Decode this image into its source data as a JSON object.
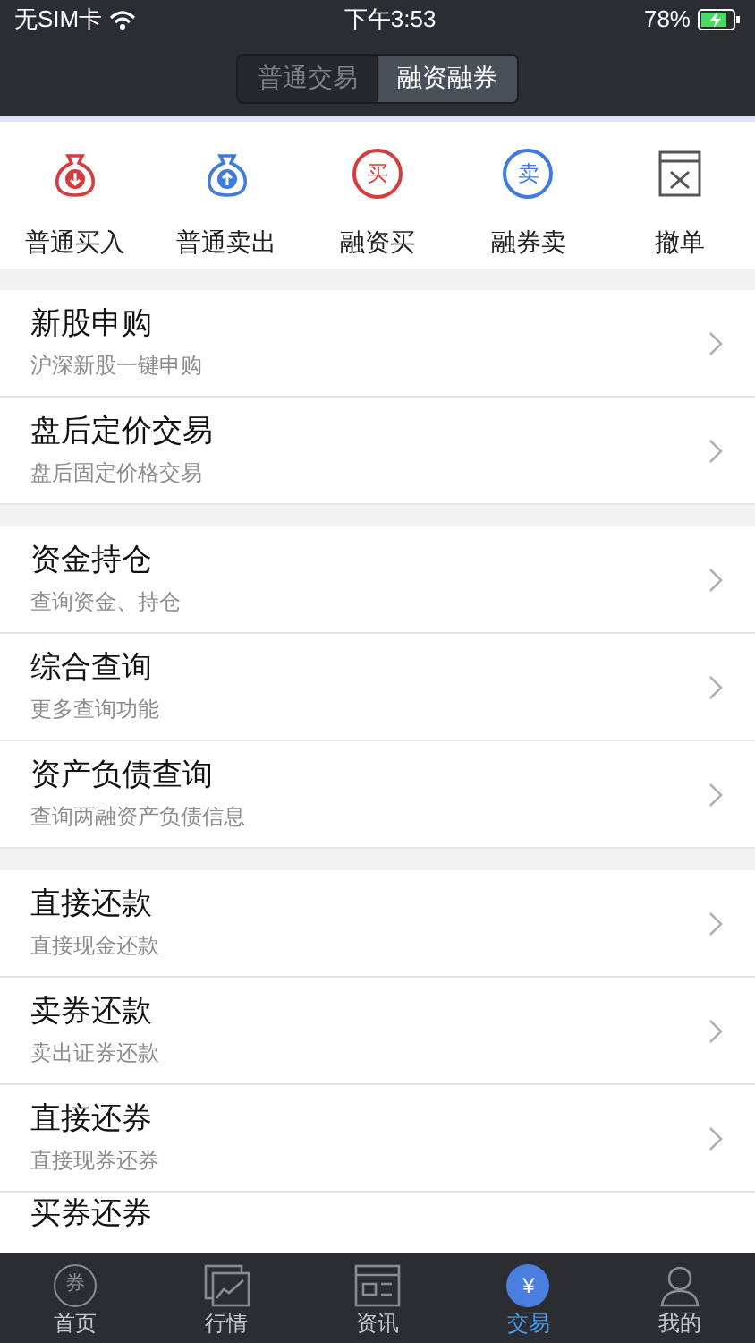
{
  "status_bar": {
    "carrier": "无SIM卡",
    "time": "下午3:53",
    "battery": "78%"
  },
  "segments": [
    {
      "label": "普通交易",
      "selected": false
    },
    {
      "label": "融资融券",
      "selected": true
    }
  ],
  "quick_actions": [
    {
      "label": "普通买入",
      "kind": "bag",
      "color": "#d63c3c"
    },
    {
      "label": "普通卖出",
      "kind": "bag",
      "color": "#3d7be0"
    },
    {
      "label": "融资买",
      "kind": "coin",
      "glyph": "买",
      "color": "#d63c3c"
    },
    {
      "label": "融券卖",
      "kind": "coin",
      "glyph": "卖",
      "color": "#3d7be0"
    },
    {
      "label": "撤单",
      "kind": "cancel",
      "color": "#555555"
    }
  ],
  "sections": [
    {
      "items": [
        {
          "title": "新股申购",
          "subtitle": "沪深新股一键申购"
        },
        {
          "title": "盘后定价交易",
          "subtitle": "盘后固定价格交易"
        }
      ]
    },
    {
      "items": [
        {
          "title": "资金持仓",
          "subtitle": "查询资金、持仓"
        },
        {
          "title": "综合查询",
          "subtitle": "更多查询功能"
        },
        {
          "title": "资产负债查询",
          "subtitle": "查询两融资产负债信息"
        }
      ]
    },
    {
      "items": [
        {
          "title": "直接还款",
          "subtitle": "直接现金还款"
        },
        {
          "title": "卖券还款",
          "subtitle": "卖出证券还款"
        },
        {
          "title": "直接还券",
          "subtitle": "直接现券还券"
        },
        {
          "title": "买券还券"
        }
      ]
    }
  ],
  "tab_bar": [
    {
      "label": "首页",
      "kind": "coupon",
      "glyph": "券",
      "selected": false
    },
    {
      "label": "行情",
      "kind": "chart",
      "selected": false
    },
    {
      "label": "资讯",
      "kind": "news",
      "selected": false
    },
    {
      "label": "交易",
      "kind": "yen",
      "glyph": "¥",
      "selected": true
    },
    {
      "label": "我的",
      "kind": "person",
      "selected": false
    }
  ]
}
